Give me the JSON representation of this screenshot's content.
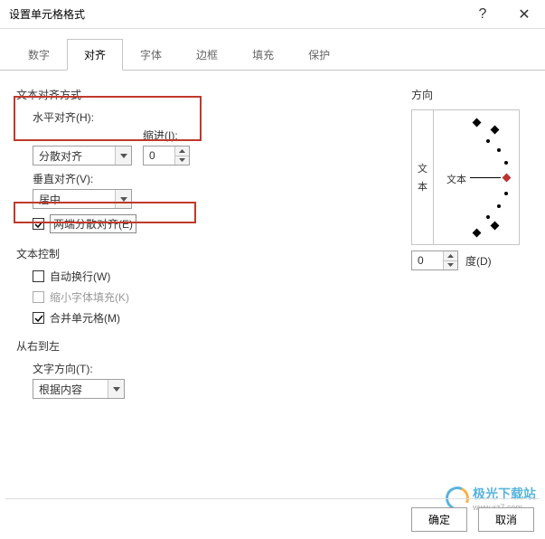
{
  "window": {
    "title": "设置单元格格式",
    "help": "?",
    "close": "✕"
  },
  "tabs": [
    "数字",
    "对齐",
    "字体",
    "边框",
    "填充",
    "保护"
  ],
  "active_tab": 1,
  "align": {
    "section": "文本对齐方式",
    "h_label": "水平对齐(H):",
    "h_value": "分散对齐",
    "indent_label": "缩进(I):",
    "indent_value": "0",
    "v_label": "垂直对齐(V):",
    "v_value": "居中",
    "justify_last": "两端分散对齐(E)"
  },
  "text_ctrl": {
    "section": "文本控制",
    "wrap": "自动换行(W)",
    "shrink": "缩小字体填充(K)",
    "merge": "合并单元格(M)"
  },
  "rtl": {
    "section": "从右到左",
    "dir_label": "文字方向(T):",
    "dir_value": "根据内容"
  },
  "orient": {
    "section": "方向",
    "vtext1": "文",
    "vtext2": "本",
    "htext": "文本",
    "deg_value": "0",
    "deg_label": "度(D)"
  },
  "buttons": {
    "ok": "确定",
    "cancel": "取消"
  },
  "watermark": {
    "text": "极光下载站",
    "url": "www.xz7.com"
  }
}
